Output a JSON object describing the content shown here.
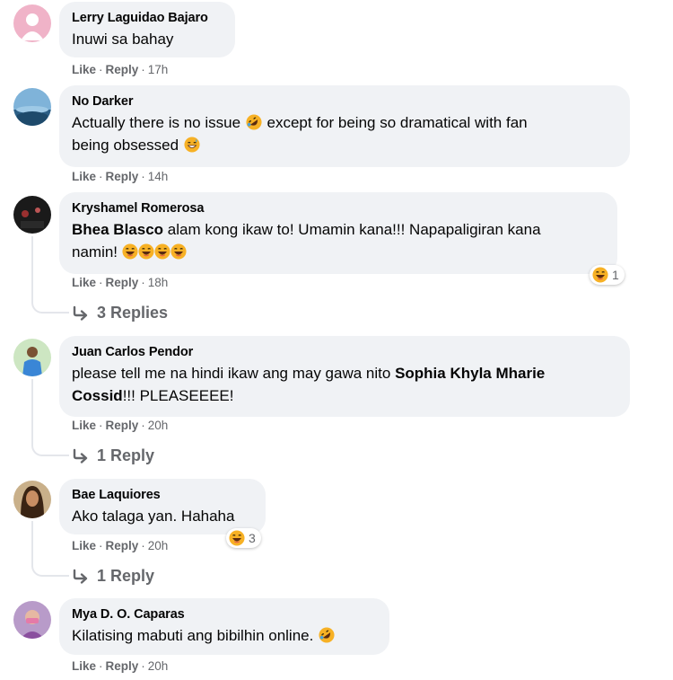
{
  "comments": [
    {
      "name": "Lerry Laguidao Bajaro",
      "text": "Inuwi sa bahay",
      "like": "Like",
      "reply": "Reply",
      "time": "17h"
    },
    {
      "name": "No Darker",
      "text_1": "Actually there is no issue",
      "text_2": "except for being so dramatical with fan",
      "text_3": "being obsessed",
      "like": "Like",
      "reply": "Reply",
      "time": "14h"
    },
    {
      "name": "Kryshamel Romerosa",
      "mention": "Bhea Blasco",
      "text_1": "alam kong ikaw to! Umamin kana!!! Napapaligiran kana",
      "text_2": "namin!",
      "like": "Like",
      "reply": "Reply",
      "time": "18h",
      "reaction_count": "1",
      "replies": "3 Replies"
    },
    {
      "name": "Juan Carlos Pendor",
      "text_1": "please tell me na hindi ikaw ang may gawa nito",
      "mention_1": "Sophia Khyla Mharie",
      "mention_2": "Cossid",
      "text_2": "!!! PLEASEEEE!",
      "like": "Like",
      "reply": "Reply",
      "time": "20h",
      "replies": "1 Reply"
    },
    {
      "name": "Bae Laquiores",
      "text": "Ako talaga yan. Hahaha",
      "like": "Like",
      "reply": "Reply",
      "time": "20h",
      "reaction_count": "3",
      "replies": "1 Reply"
    },
    {
      "name": "Mya D. O. Caparas",
      "text": "Kilatising mabuti ang bibilhin online.",
      "like": "Like",
      "reply": "Reply",
      "time": "20h"
    }
  ],
  "separator": "·",
  "colors": {
    "bubble": "#f0f2f5",
    "meta": "#65676b",
    "thread_line": "#e4e6eb",
    "emoji": "#f7b125"
  },
  "icons": {
    "laughing": "laughing-emoji-icon",
    "rofl": "rolling-laughing-emoji-icon",
    "grin": "grinning-sweat-emoji-icon",
    "reply_arrow": "reply-arrow-icon"
  }
}
